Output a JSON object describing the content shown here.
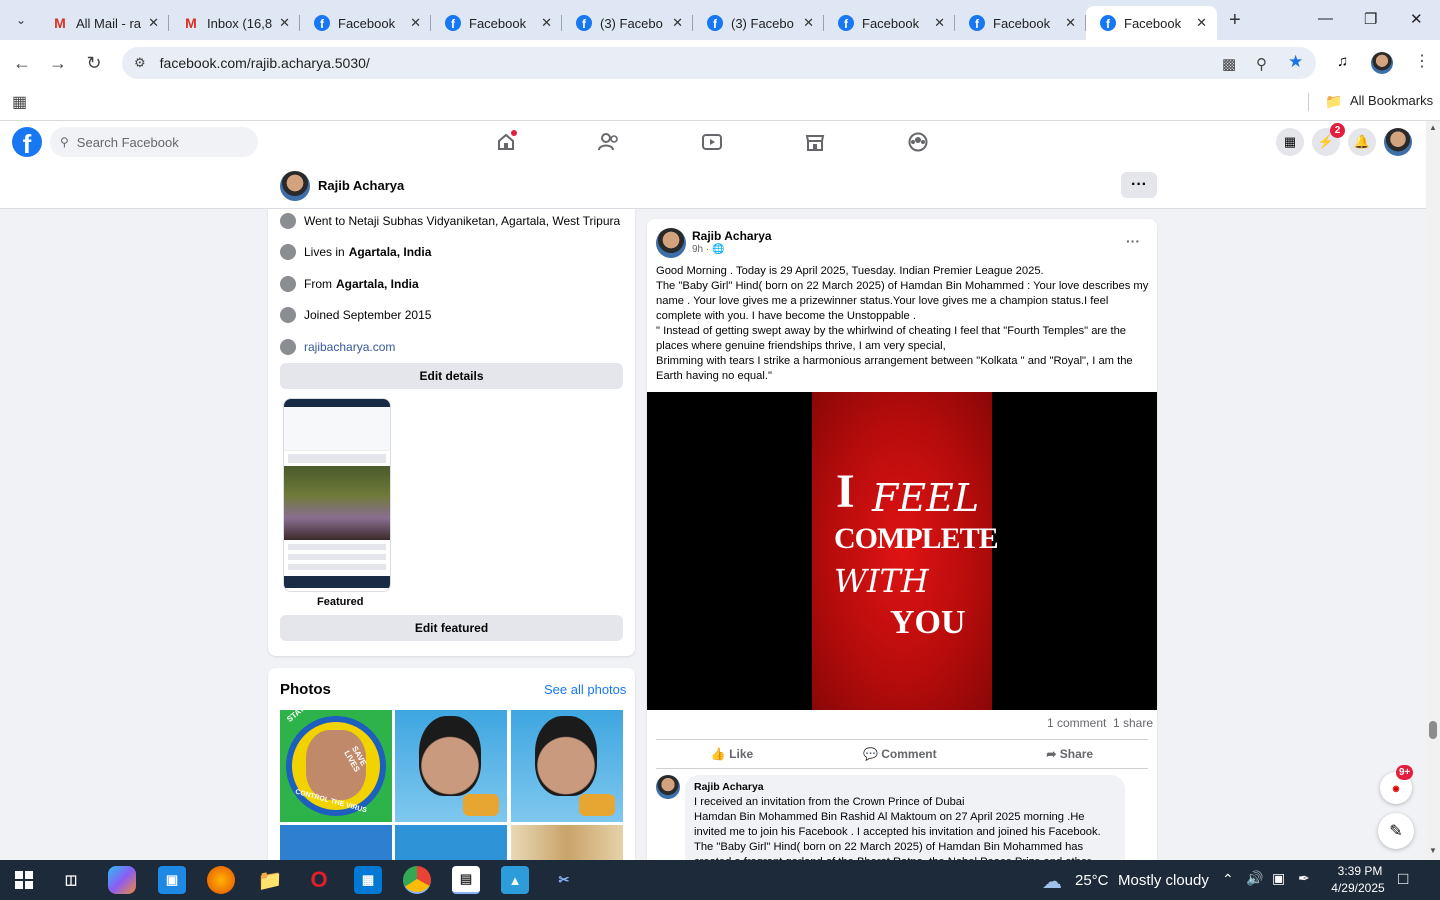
{
  "browser": {
    "tabs": [
      {
        "title": "All Mail - ra",
        "icon": "gmail-icon",
        "active": false
      },
      {
        "title": "Inbox (16,8",
        "icon": "gmail-icon",
        "active": false
      },
      {
        "title": "Facebook",
        "icon": "facebook-icon",
        "active": false
      },
      {
        "title": "Facebook",
        "icon": "facebook-icon",
        "active": false
      },
      {
        "title": "(3) Facebo",
        "icon": "facebook-icon",
        "active": false
      },
      {
        "title": "(3) Facebo",
        "icon": "facebook-icon",
        "active": false
      },
      {
        "title": "Facebook",
        "icon": "facebook-icon",
        "active": false
      },
      {
        "title": "Facebook",
        "icon": "facebook-icon",
        "active": false
      },
      {
        "title": "Facebook",
        "icon": "facebook-icon",
        "active": true
      }
    ],
    "url": "facebook.com/rajib.acharya.5030/",
    "bookmarks_label": "All Bookmarks"
  },
  "facebook": {
    "search_placeholder": "Search Facebook",
    "messenger_badge": "2",
    "profile_name": "Rajib Acharya",
    "intro": {
      "education": "Went to Netaji Subhas Vidyaniketan, Agartala, West Tripura",
      "lives_prefix": "Lives in",
      "lives": "Agartala, India",
      "from_prefix": "From",
      "from": "Agartala, India",
      "joined": "Joined September 2015",
      "website": "rajibacharya.com",
      "edit_details": "Edit details",
      "featured_label": "Featured",
      "edit_featured": "Edit featured"
    },
    "photos": {
      "title": "Photos",
      "see_all": "See all photos",
      "photo1_top": "STAY ALERT",
      "photo1_right": "SAVE LIVES",
      "photo1_bottom": "CONTROL THE VIRUS"
    },
    "post": {
      "author": "Rajib Acharya",
      "time": "9h ·",
      "text_lines": [
        "Good Morning . Today is 29 April 2025, Tuesday. Indian Premier League 2025.",
        "The \"Baby Girl\" Hind( born on 22 March 2025) of Hamdan Bin Mohammed : Your love describes my",
        "name . Your love gives me a prizewinner status.Your love gives me a champion status.I feel",
        "complete with you. I have become the Unstoppable .",
        "\" Instead of getting swept away by the whirlwind of cheating I feel that \"Fourth Temples\" are the",
        "places where genuine friendships thrive, I am very special,",
        "Brimming with tears I strike a harmonious arrangement between \"Kolkata \" and \"Royal\", I am the",
        "Earth having no equal.\""
      ],
      "image_text": [
        "I",
        "FEEL",
        "COMPLETE",
        "WITH",
        "YOU"
      ],
      "comments_count": "1 comment",
      "shares_count": "1 share",
      "like": "Like",
      "comment": "Comment",
      "share": "Share"
    },
    "comment": {
      "author": "Rajib Acharya",
      "lines": [
        "I received an invitation from the Crown Prince of Dubai",
        "Hamdan Bin Mohammed Bin Rashid Al Maktoum on 27 April 2025 morning .He",
        "invited me to join his Facebook . I accepted his invitation and joined his Facebook.",
        "The \"Baby Girl\" Hind( born on 22 March 2025) of Hamdan Bin Mohammed has",
        "created a fragrant garland of the Bharat Ratna, the Nobel Peace Prize and other"
      ]
    },
    "floating_badge": "9+"
  },
  "taskbar": {
    "temperature": "25°C",
    "weather": "Mostly cloudy",
    "time": "3:39 PM",
    "date": "4/29/2025"
  },
  "colors": {
    "facebook_blue": "#1877f2",
    "taskbar": "#1c2a3a",
    "tab_strip": "#dfe7f5"
  }
}
